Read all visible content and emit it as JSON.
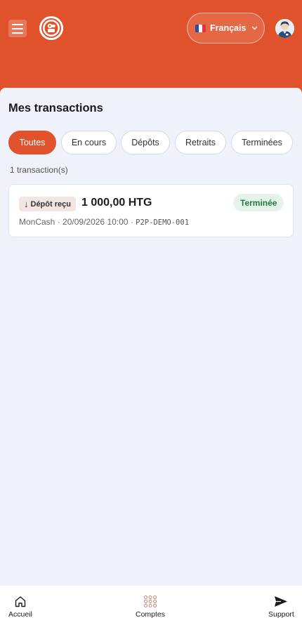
{
  "header": {
    "language": {
      "label": "Français",
      "flag": "fr"
    },
    "colors": {
      "brand": "#e0522b"
    }
  },
  "page": {
    "title": "Mes transactions"
  },
  "filters": [
    "Toutes",
    "En cours",
    "Dépôts",
    "Retraits",
    "Terminées"
  ],
  "active_filter": "Toutes",
  "count_label": "1 transaction(s)",
  "transactions": [
    {
      "type_arrow": "↓",
      "type_label": "Dépôt reçu",
      "amount": "1 000,00 HTG",
      "status": "Terminée",
      "method": "MonCash",
      "datetime": "20/09/2026 10:00",
      "reference": "P2P-DEMO-001"
    }
  ],
  "bottom_nav": [
    {
      "label": "Accueil",
      "icon": "home-icon"
    },
    {
      "label": "Comptes",
      "icon": "grid-icon"
    },
    {
      "label": "Support",
      "icon": "send-icon"
    }
  ]
}
